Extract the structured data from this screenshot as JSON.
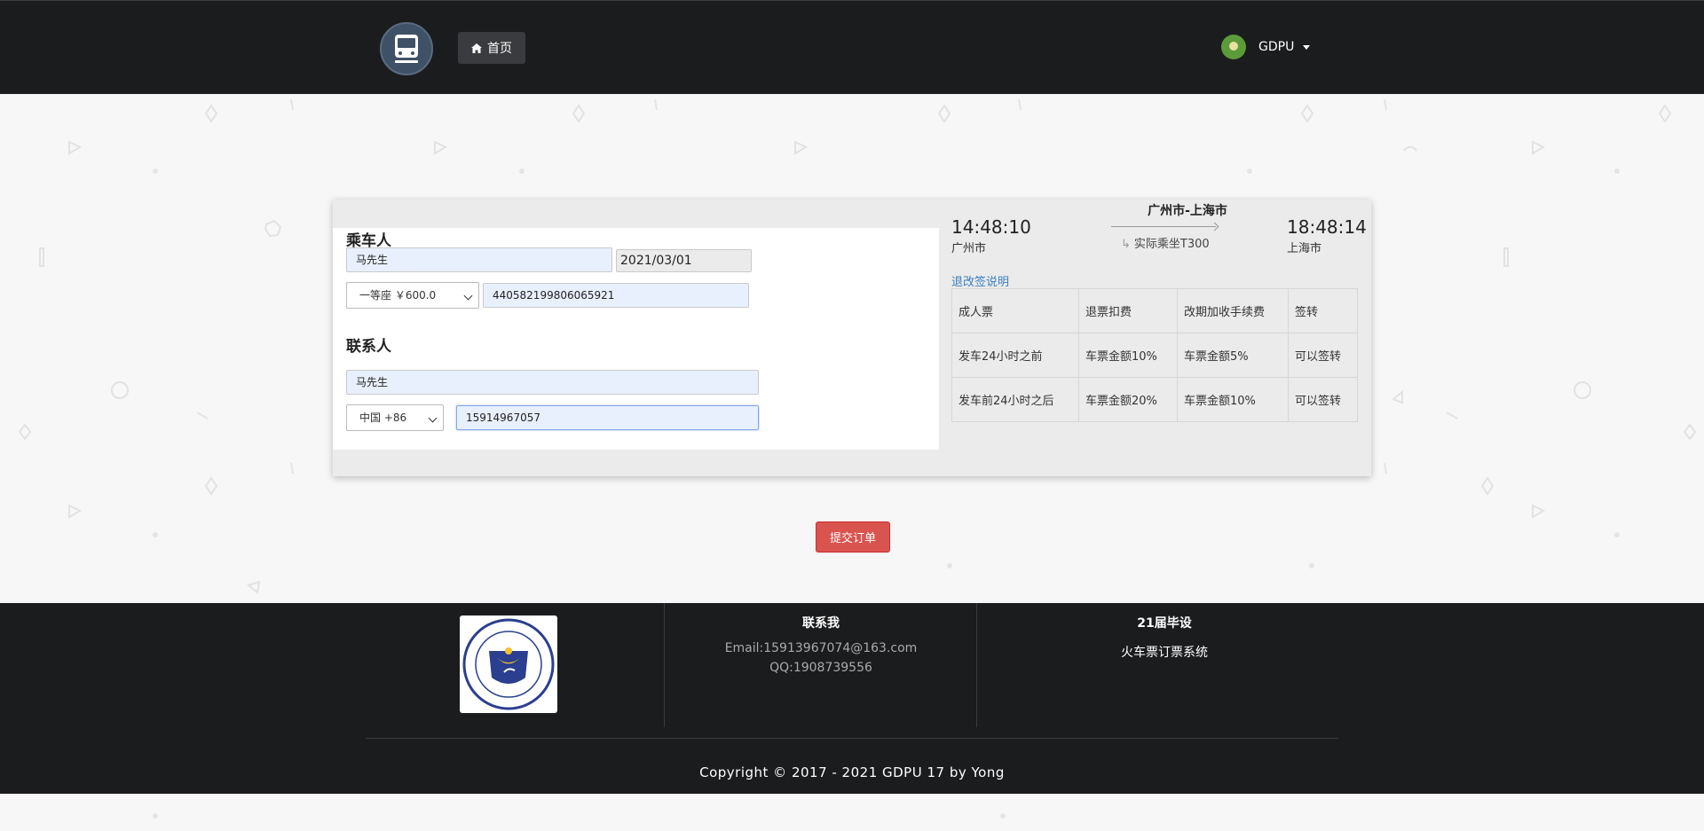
{
  "header": {
    "logo_icon": "train-icon",
    "home_label": "首页",
    "home_icon": "home-icon",
    "user_name": "GDPU",
    "user_avatar_icon": "avatar-image",
    "dropdown_icon": "caret-down-icon"
  },
  "passenger": {
    "title": "乘车人",
    "name_value": "马先生",
    "date_value": "2021/03/01",
    "seat_selected": "一等座 ￥600.0",
    "id_value": "440582199806065921"
  },
  "contact": {
    "title": "联系人",
    "name_value": "马先生",
    "country_selected": "中国 +86",
    "phone_value": "15914967057"
  },
  "trip": {
    "depart_time": "14:48:10",
    "depart_city": "广州市",
    "route": "广州市-上海市",
    "actual_train": "实际乘坐T300",
    "arrive_time": "18:48:14",
    "arrive_city": "上海市"
  },
  "policy": {
    "link_label": "退改签说明",
    "headers": [
      "成人票",
      "退票扣费",
      "改期加收手续费",
      "签转"
    ],
    "rows": [
      [
        "发车24小时之前",
        "车票金额10%",
        "车票金额5%",
        "可以签转"
      ],
      [
        "发车前24小时之后",
        "车票金额20%",
        "车票金额10%",
        "可以签转"
      ]
    ]
  },
  "submit_label": "提交订单",
  "footer": {
    "logo_name": "gdpu-school-logo",
    "contact_title": "联系我",
    "email": "Email:15913967074@163.com",
    "qq": "QQ:1908739556",
    "project_title": "21届毕设",
    "project_desc": "火车票订票系统",
    "copyright": "Copyright © 2017 - 2021 GDPU 17 by Yong"
  },
  "colors": {
    "header_bg": "#1b1c1e",
    "submit_bg": "#d9534f",
    "link": "#3a7fc1",
    "input_autofill": "#e8f0fe"
  }
}
